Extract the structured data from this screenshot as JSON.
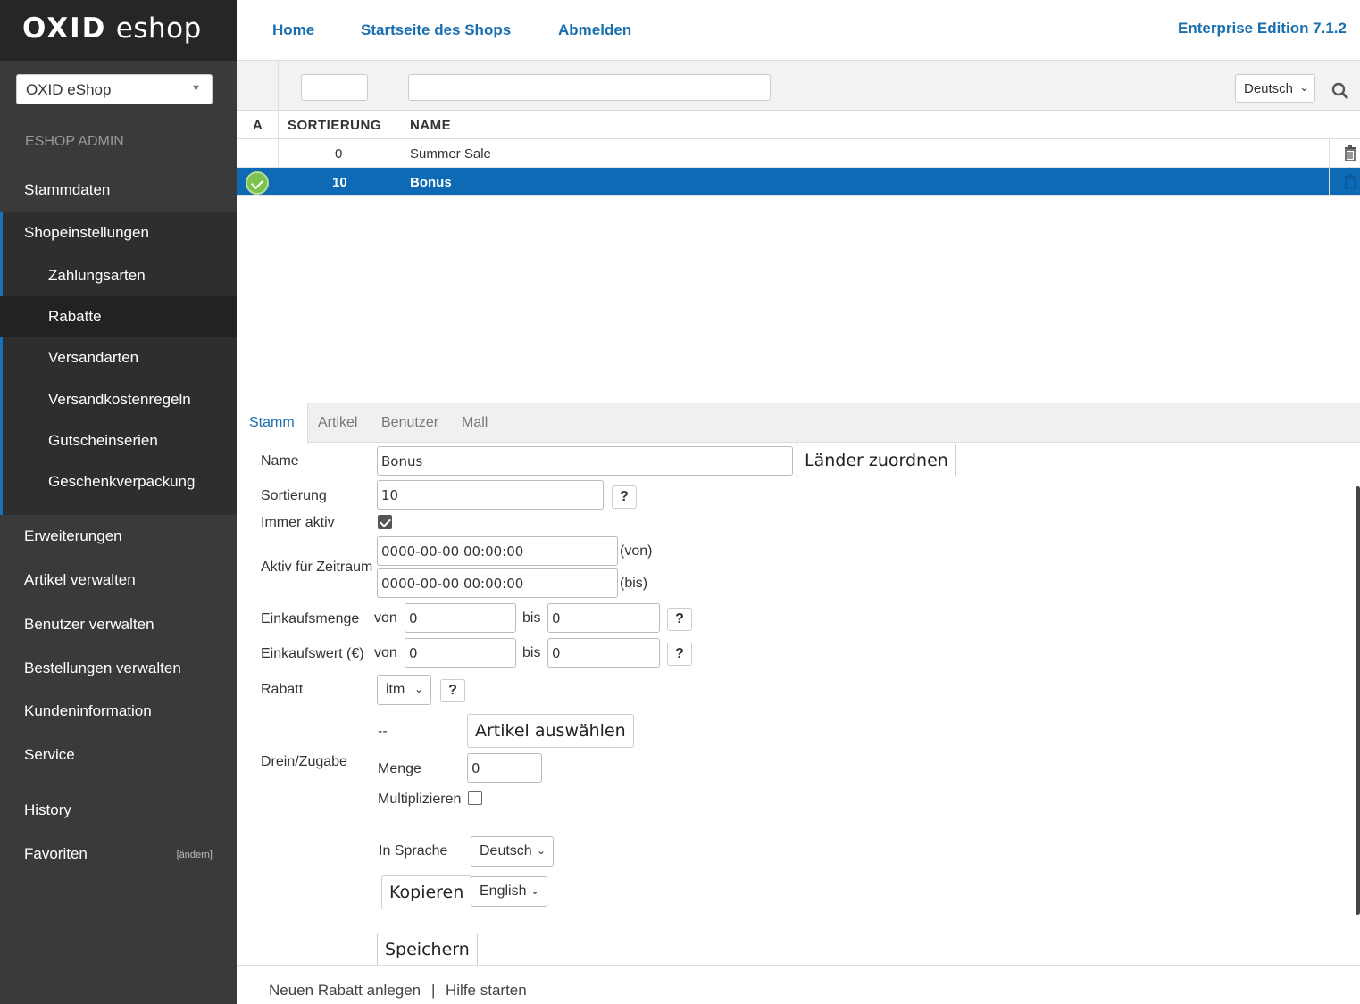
{
  "brand": {
    "logo_bold": "OXID",
    "logo_light": "eshop"
  },
  "shop_select": {
    "value": "OXID eShop"
  },
  "sidebar": {
    "section": "ESHOP ADMIN",
    "items": [
      "Stammdaten",
      "Shopeinstellungen",
      "Erweiterungen",
      "Artikel verwalten",
      "Benutzer verwalten",
      "Bestellungen verwalten",
      "Kundeninformation",
      "Service",
      "History",
      "Favoriten"
    ],
    "sub_items": [
      "Zahlungsarten",
      "Rabatte",
      "Versandarten",
      "Versandkostenregeln",
      "Gutscheinserien",
      "Geschenkverpackung"
    ],
    "active_sub": "Rabatte",
    "fav_edit": "[ändern]"
  },
  "top": {
    "links": [
      "Home",
      "Startseite des Shops",
      "Abmelden"
    ],
    "edition": "Enterprise Edition 7.1.2"
  },
  "filter": {
    "language": "Deutsch"
  },
  "list": {
    "headers": [
      "A",
      "SORTIERUNG",
      "NAME"
    ],
    "rows": [
      {
        "sort": "0",
        "name": "Summer Sale",
        "active": false
      },
      {
        "sort": "10",
        "name": "Bonus",
        "active": true
      }
    ]
  },
  "tabs": [
    "Stamm",
    "Artikel",
    "Benutzer",
    "Mall"
  ],
  "form": {
    "name_label": "Name",
    "name_value": "Bonus",
    "countries_button": "Länder zuordnen",
    "sort_label": "Sortierung",
    "sort_value": "10",
    "help": "?",
    "always_active_label": "Immer aktiv",
    "period_label": "Aktiv für Zeitraum",
    "from_value": "0000-00-00 00:00:00",
    "from_suffix": "(von)",
    "to_value": "0000-00-00 00:00:00",
    "to_suffix": "(bis)",
    "amount_label": "Einkaufsmenge",
    "von": "von",
    "bis": "bis",
    "amount_from": "0",
    "amount_to": "0",
    "price_label": "Einkaufswert (€)",
    "price_from": "0",
    "price_to": "0",
    "discount_label": "Rabatt",
    "discount_type": "itm",
    "bonus_label": "Drein/Zugabe",
    "bonus_article": "--",
    "select_article_button": "Artikel auswählen",
    "quantity_label": "Menge",
    "quantity_value": "0",
    "multiply_label": "Multiplizieren",
    "language_label": "In Sprache",
    "language_value": "Deutsch",
    "copy_button": "Kopieren",
    "copy_language": "English",
    "save_button": "Speichern"
  },
  "footer": {
    "new_link": "Neuen Rabatt anlegen",
    "separator": "|",
    "help_link": "Hilfe starten"
  }
}
